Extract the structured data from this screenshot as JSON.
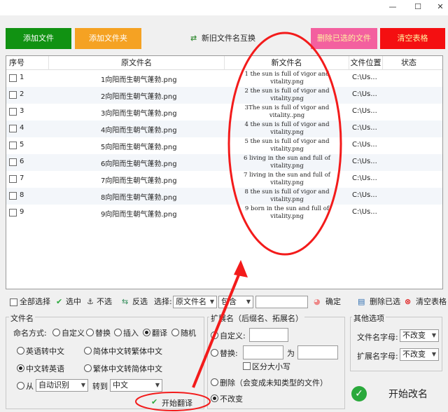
{
  "window": {
    "minimize": "—",
    "maximize": "☐",
    "close": "✕"
  },
  "top_buttons": {
    "add_file": "添加文件",
    "add_folder": "添加文件夹",
    "swap_names": "新旧文件名互换",
    "delete_selected": "删除已选的文件",
    "clear_table": "清空表格"
  },
  "table": {
    "headers": {
      "index": "序号",
      "old_name": "原文件名",
      "new_name": "新文件名",
      "location": "文件位置",
      "status": "状态"
    },
    "rows": [
      {
        "index": "1",
        "old_name": "1向阳而生朝气蓬勃.png",
        "new_name": "1 the sun is full of vigor and vitality.png",
        "location": "C:\\Us..."
      },
      {
        "index": "2",
        "old_name": "2向阳而生朝气蓬勃.png",
        "new_name": "2 the sun is full of vigor and vitality.png",
        "location": "C:\\Us..."
      },
      {
        "index": "3",
        "old_name": "3向阳而生朝气蓬勃.png",
        "new_name": "3The sun is full of vigor and vitality..png",
        "location": "C:\\Us..."
      },
      {
        "index": "4",
        "old_name": "4向阳而生朝气蓬勃.png",
        "new_name": "4 the sun is full of vigor and vitality.png",
        "location": "C:\\Us..."
      },
      {
        "index": "5",
        "old_name": "5向阳而生朝气蓬勃.png",
        "new_name": "5 the sun is full of vigor and vitality.png",
        "location": "C:\\Us..."
      },
      {
        "index": "6",
        "old_name": "6向阳而生朝气蓬勃.png",
        "new_name": "6 living in the sun and full of vitality.png",
        "location": "C:\\Us..."
      },
      {
        "index": "7",
        "old_name": "7向阳而生朝气蓬勃.png",
        "new_name": "7 living in the sun and full of vitality.png",
        "location": "C:\\Us..."
      },
      {
        "index": "8",
        "old_name": "8向阳而生朝气蓬勃.png",
        "new_name": "8 the sun is full of vigor and vitality.png",
        "location": "C:\\Us..."
      },
      {
        "index": "9",
        "old_name": "9向阳而生朝气蓬勃.png",
        "new_name": "9 born in the sun and full of vitality.png",
        "location": "C:\\Us..."
      }
    ]
  },
  "toolbar": {
    "select_all": "全部选择",
    "select": "选中",
    "deselect": "不选",
    "invert": "反选",
    "choose_label": "选择:",
    "choose_field": "原文件名",
    "choose_mode": "包含",
    "choose_value": "",
    "confirm": "确定",
    "delete_selected": "删除已选",
    "clear_table": "清空表格"
  },
  "filename_group": {
    "title": "文件名",
    "mode_label": "命名方式:",
    "modes": {
      "custom": "自定义",
      "replace": "替换",
      "insert": "插入",
      "translate": "翻译",
      "random": "随机"
    },
    "options": {
      "en_to_zh": "英语转中文",
      "simp_to_trad": "简体中文转繁体中文",
      "zh_to_en": "中文转英语",
      "trad_to_simp": "繁体中文转简体中文",
      "from": "从",
      "from_value": "自动识别",
      "to": "转到",
      "to_value": "中文"
    },
    "start_translate": "开始翻译"
  },
  "extension_group": {
    "title": "扩展名（后缀名、拓展名）",
    "custom": "自定义:",
    "replace": "替换:",
    "replace_to": "为",
    "case_sensitive": "区分大小写",
    "delete": "删除（会变成未知类型的文件）",
    "unchanged": "不改变"
  },
  "other_group": {
    "title": "其他选项",
    "filename_case_label": "文件名字母:",
    "filename_case_value": "不改变",
    "ext_case_label": "扩展名字母:",
    "ext_case_value": "不改变"
  },
  "start_rename": "开始改名",
  "colors": {
    "add_file": "#119212",
    "add_folder": "#f5a223",
    "delete_selected": "#f3609f",
    "clear_table": "#f40f11",
    "annotation": "#f31b1b"
  }
}
